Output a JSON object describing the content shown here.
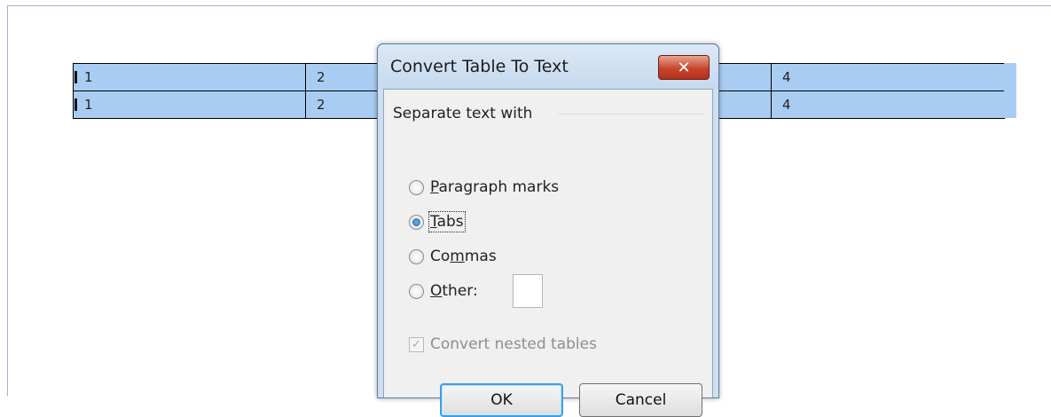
{
  "table": {
    "rows": [
      [
        "1",
        "2",
        "",
        "4"
      ],
      [
        "1",
        "2",
        "",
        "4"
      ]
    ]
  },
  "dialog": {
    "title": "Convert Table To Text",
    "close_label": "✕",
    "group_label": "Separate text with",
    "options": [
      {
        "pre": "",
        "accel": "P",
        "post": "aragraph marks",
        "selected": false
      },
      {
        "pre": "",
        "accel": "T",
        "post": "abs",
        "selected": true
      },
      {
        "pre": "Co",
        "accel": "m",
        "post": "mas",
        "selected": false
      },
      {
        "pre": "",
        "accel": "O",
        "post": "ther:",
        "selected": false
      }
    ],
    "other_value": "",
    "nested_label": "Convert nested tables",
    "nested_checked": true,
    "ok_label": "OK",
    "cancel_label": "Cancel"
  }
}
